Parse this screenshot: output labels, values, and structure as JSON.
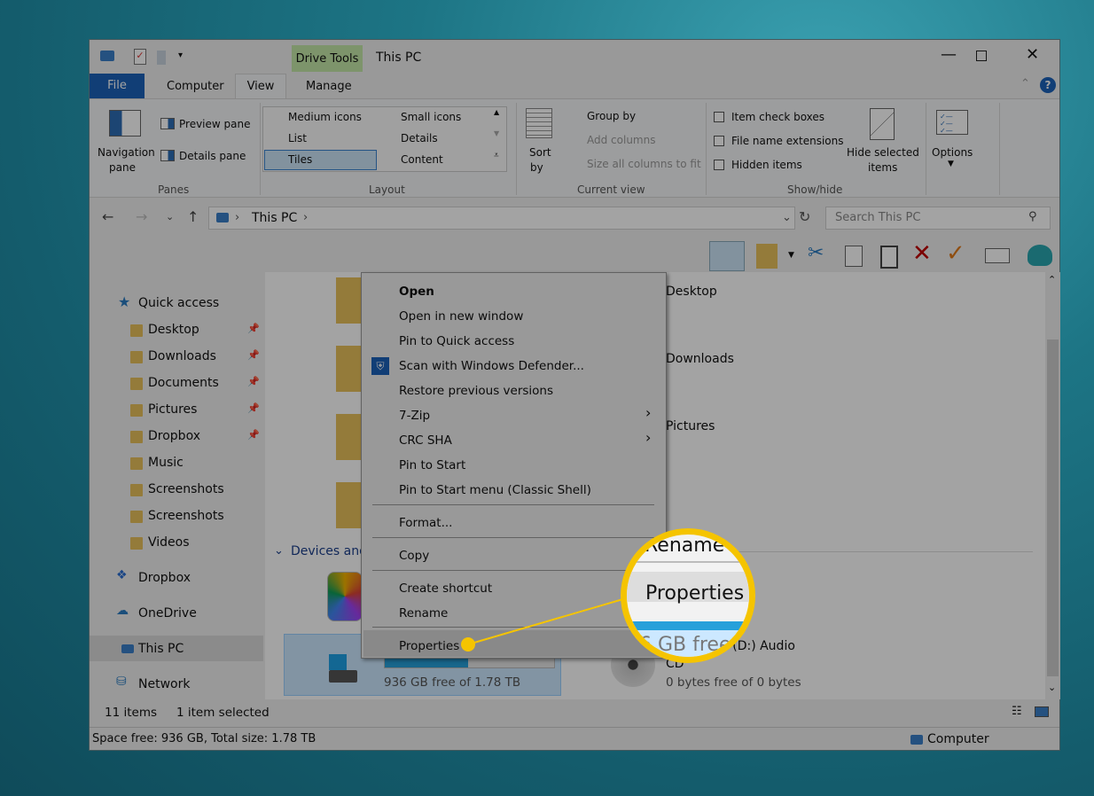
{
  "colors": {
    "accent": "#1c62b9",
    "drive_tools": "#c4e8a8",
    "callout": "#f5c400",
    "delete": "#c00000",
    "check": "#e07a1a"
  },
  "titlebar": {
    "title": "This PC",
    "context_tab": "Drive Tools"
  },
  "tabs": [
    {
      "label": "File"
    },
    {
      "label": "Computer"
    },
    {
      "label": "View"
    },
    {
      "label": "Manage"
    }
  ],
  "ribbon": {
    "panes": {
      "nav": "Navigation",
      "nav2": "pane",
      "preview": "Preview pane",
      "details": "Details pane",
      "group": "Panes"
    },
    "layout": {
      "items": [
        "Medium icons",
        "Small icons",
        "List",
        "Details",
        "Tiles",
        "Content"
      ],
      "selected": "Tiles",
      "group": "Layout"
    },
    "current_view": {
      "sort": "Sort",
      "sort2": "by",
      "group_by": "Group by",
      "add_columns": "Add columns",
      "size_columns": "Size all columns to fit",
      "group": "Current view"
    },
    "show_hide": {
      "item_check": "Item check boxes",
      "extensions": "File name extensions",
      "hidden": "Hidden items",
      "hide_selected": "Hide selected",
      "hide_selected2": "items",
      "group": "Show/hide"
    },
    "options": "Options"
  },
  "address": {
    "path": "This PC",
    "search_placeholder": "Search This PC"
  },
  "nav": {
    "quick_access": "Quick access",
    "items": [
      {
        "label": "Desktop",
        "pinned": true
      },
      {
        "label": "Downloads",
        "pinned": true
      },
      {
        "label": "Documents",
        "pinned": true
      },
      {
        "label": "Pictures",
        "pinned": true
      },
      {
        "label": "Dropbox",
        "pinned": true
      },
      {
        "label": "Music"
      },
      {
        "label": "Screenshots"
      },
      {
        "label": "Screenshots"
      },
      {
        "label": "Videos"
      }
    ],
    "roots": [
      "Dropbox",
      "OneDrive",
      "This PC",
      "Network"
    ],
    "selected": "This PC"
  },
  "content": {
    "folders": [
      "Desktop",
      "Downloads",
      "Pictures"
    ],
    "section": "Devices and drives",
    "drive_c": {
      "free": "936 GB free of 1.78 TB",
      "used_fraction": 0.49
    },
    "drive_d": {
      "name": "DVD RW Drive (D:) Audio CD",
      "name_visible": "ive (D:) Audio",
      "name2": "CD",
      "free": "0 bytes free of 0 bytes"
    }
  },
  "context_menu": {
    "items": [
      "Open",
      "Open in new window",
      "Pin to Quick access",
      "Scan with Windows Defender...",
      "Restore previous versions",
      "7-Zip",
      "CRC SHA",
      "Pin to Start",
      "Pin to Start menu (Classic Shell)",
      "Format...",
      "Copy",
      "Create shortcut",
      "Rename",
      "Properties"
    ],
    "highlighted": "Properties"
  },
  "magnifier": {
    "top": "Rename",
    "middle": "Properties",
    "bottom": "6 GB free"
  },
  "status": {
    "count": "11 items",
    "selected": "1 item selected",
    "space": "Space free: 936 GB, Total size: 1.78 TB",
    "location": "Computer"
  }
}
